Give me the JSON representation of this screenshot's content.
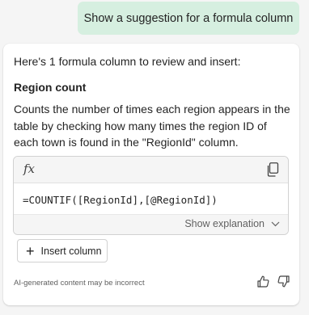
{
  "user_message": "Show a suggestion for a formula column",
  "response": {
    "intro": "Here's 1 formula column to review and insert:",
    "column_name": "Region count",
    "description": "Counts the number of times each region appears in the table by checking how many times the region ID of each town is found in the \"RegionId\" column.",
    "formula": "=COUNTIF([RegionId],[@RegionId])",
    "show_explanation_label": "Show explanation",
    "insert_button_label": "Insert column",
    "disclaimer": "AI-generated content may be incorrect"
  },
  "icons": {
    "formula": "fx-icon",
    "copy": "copy-icon",
    "expand": "chevron-down-icon",
    "add": "plus-icon",
    "like": "thumbs-up-icon",
    "dislike": "thumbs-down-icon"
  },
  "colors": {
    "user_bubble": "#d6efe0",
    "card": "#ffffff",
    "background": "#f5f5f5"
  }
}
